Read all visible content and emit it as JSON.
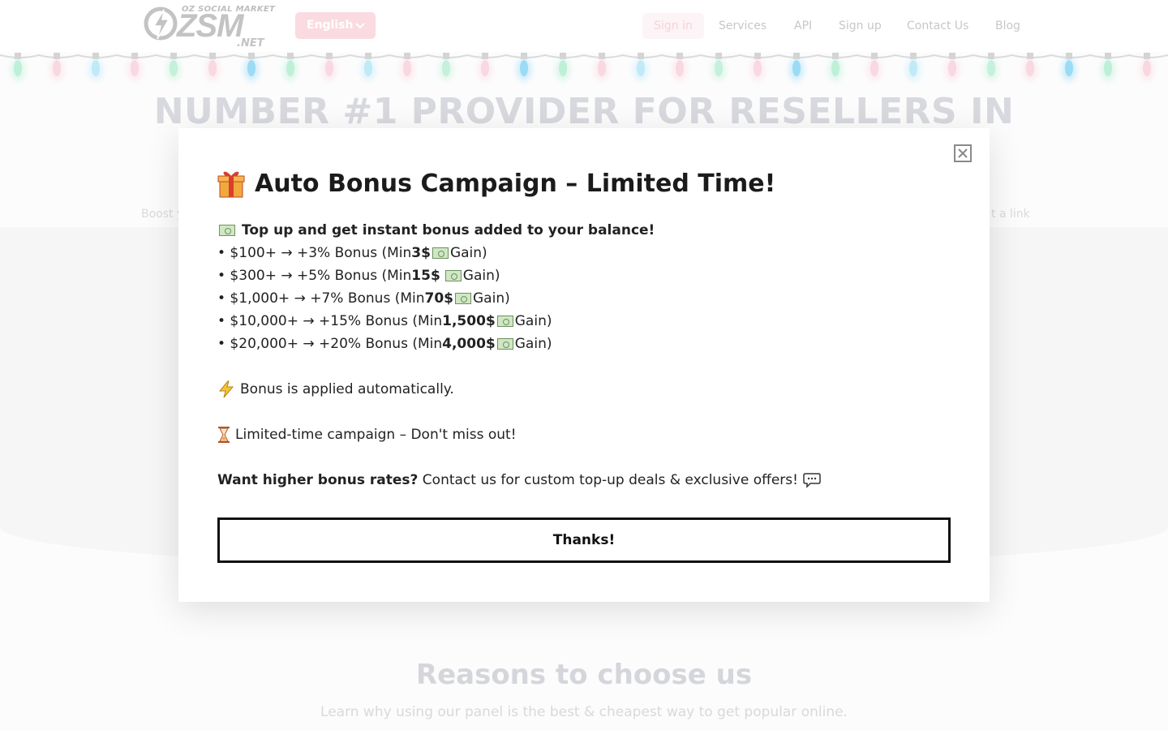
{
  "header": {
    "logo_small": "OZ SOCIAL MARKET",
    "logo_big": "ZSM",
    "logo_net": ".NET",
    "language": "English",
    "nav": {
      "sign_in": "Sign in",
      "services": "Services",
      "api": "API",
      "sign_up": "Sign up",
      "contact": "Contact Us",
      "blog": "Blog"
    }
  },
  "hero": {
    "title": "NUMBER #1 PROVIDER FOR RESELLERS IN",
    "left_fragment": "Boost y",
    "right_fragment": "t a link"
  },
  "reasons": {
    "title": "Reasons to choose us",
    "subtitle": "Learn why using our panel is the best & cheapest way to get popular online."
  },
  "modal": {
    "title": "Auto Bonus Campaign – Limited Time!",
    "intro": "Top up and get instant bonus added to your balance!",
    "tiers": [
      {
        "prefix": "• $100+ → +3% Bonus (Min ",
        "min": "3$",
        "suffix": " Gain)"
      },
      {
        "prefix": "• $300+ → +5% Bonus (Min ",
        "min": "15$",
        "suffix": "Gain)"
      },
      {
        "prefix": "• $1,000+ → +7% Bonus (Min ",
        "min": "70$",
        "suffix": " Gain)"
      },
      {
        "prefix": "• $10,000+ → +15% Bonus (Min ",
        "min": "1,500$",
        "suffix": " Gain)"
      },
      {
        "prefix": "• $20,000+ → +20% Bonus (Min ",
        "min": "4,000$",
        "suffix": " Gain)"
      }
    ],
    "auto_note": "Bonus is applied automatically.",
    "limited_note": "Limited-time campaign – Don't miss out!",
    "contact_bold": "Want higher bonus rates?",
    "contact_rest": " Contact us for custom top-up deals & exclusive offers!",
    "button": "Thanks!"
  },
  "icons": {
    "close": "close-icon",
    "gift": "gift-icon",
    "cash": "dollar-banknote-icon",
    "bolt": "lightning-icon",
    "hourglass": "hourglass-icon",
    "speech": "speech-bubble-icon"
  },
  "colors": {
    "accent_pink": "#f6c8d2",
    "modal_text": "#222222",
    "button_border": "#111111"
  }
}
